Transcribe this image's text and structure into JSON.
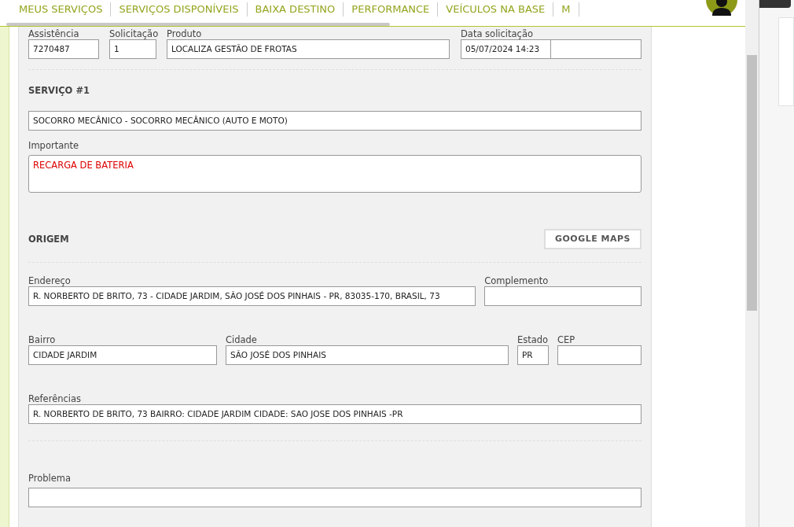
{
  "nav": {
    "items": [
      {
        "label": "MEUS SERVIÇOS"
      },
      {
        "label": "SERVIÇOS DISPONÍVEIS"
      },
      {
        "label": "BAIXA DESTINO"
      },
      {
        "label": "PERFORMANCE"
      },
      {
        "label": "VEÍCULOS NA BASE"
      },
      {
        "label": "M"
      }
    ]
  },
  "header_fields": [
    {
      "label": "Assistência",
      "value": "7270487"
    },
    {
      "label": "Solicitação",
      "value": "1"
    },
    {
      "label": "Produto",
      "value": "LOCALIZA GESTÃO DE FROTAS"
    },
    {
      "label": "Data solicitação",
      "value": "05/07/2024 14:23",
      "kind": "split"
    }
  ],
  "service": {
    "title": "SERVIÇO #1",
    "value": "SOCORRO MECÂNICO - SOCORRO MECÂNICO (AUTO E MOTO)",
    "important_label": "Importante",
    "important_value": "RECARGA DE BATERIA"
  },
  "origin": {
    "title": "ORIGEM",
    "button": "GOOGLE MAPS",
    "address": {
      "label": "Endereço",
      "value": "R. NORBERTO DE BRITO, 73 - CIDADE JARDIM, SÃO JOSÉ DOS PINHAIS - PR, 83035-170, BRASIL, 73"
    },
    "complement": {
      "label": "Complemento"
    },
    "district": {
      "label": "Bairro",
      "value": "CIDADE JARDIM"
    },
    "city": {
      "label": "Cidade",
      "value": "SÃO JOSÉ DOS PINHAIS"
    },
    "state": {
      "label": "Estado",
      "value": "PR"
    },
    "zip": {
      "label": "CEP"
    },
    "references": {
      "label": "Referências",
      "value": "R. NORBERTO DE BRITO, 73 BAIRRO: CIDADE JARDIM CIDADE: SAO JOSE DOS PINHAIS -PR"
    }
  },
  "problem": {
    "label": "Problema"
  }
}
